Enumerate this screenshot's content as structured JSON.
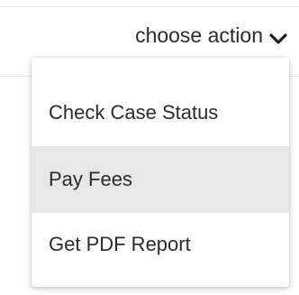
{
  "action_dropdown": {
    "trigger_label": "choose action",
    "trigger_icon": "chevron-down-icon",
    "items": [
      {
        "label": "Check Case Status",
        "highlighted": false
      },
      {
        "label": "Pay Fees",
        "highlighted": true
      },
      {
        "label": "Get PDF Report",
        "highlighted": false
      }
    ],
    "colors": {
      "text": "#2b2b2b",
      "highlight": "#e7e7e7"
    }
  }
}
